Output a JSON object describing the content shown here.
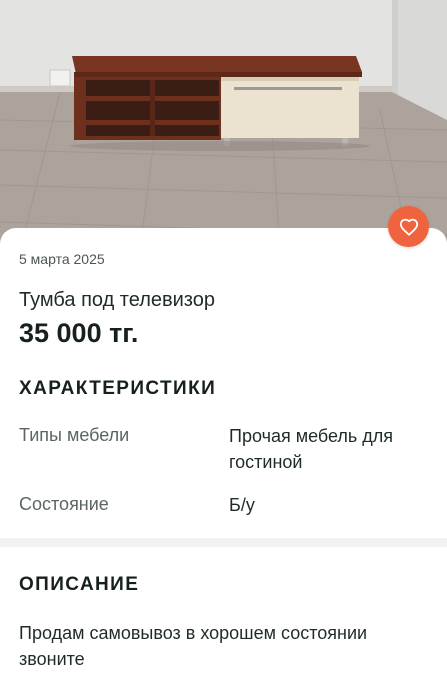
{
  "listing": {
    "date": "5 марта 2025",
    "title": "Тумба под телевизор",
    "price": "35 000 тг."
  },
  "characteristics": {
    "heading": "ХАРАКТЕРИСТИКИ",
    "items": [
      {
        "label": "Типы мебели",
        "value": "Прочая мебель для гостиной"
      },
      {
        "label": "Состояние",
        "value": "Б/у"
      }
    ]
  },
  "description": {
    "heading": "ОПИСАНИЕ",
    "text": "Продам самовывоз в хорошем состоянии звоните"
  },
  "icons": {
    "favorite": "heart-icon"
  },
  "colors": {
    "accent": "#f0633f",
    "text": "#1f2b2a"
  }
}
